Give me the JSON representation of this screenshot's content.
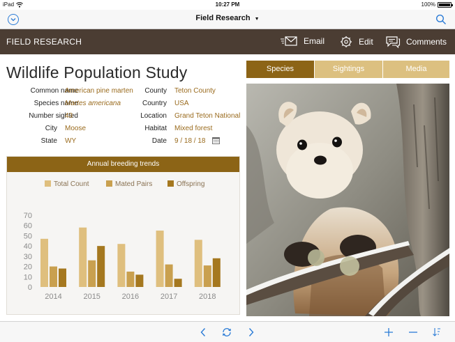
{
  "status_bar": {
    "device": "iPad",
    "time": "10:27 PM",
    "battery": "100%"
  },
  "nav": {
    "title": "Field Research"
  },
  "header": {
    "brand": "FIELD RESEARCH",
    "email_label": "Email",
    "edit_label": "Edit",
    "comments_label": "Comments"
  },
  "page_title": "Wildlife Population Study",
  "fields_left": [
    {
      "label": "Common name",
      "value": "American pine marten"
    },
    {
      "label": "Species name",
      "value": "Martes americana"
    },
    {
      "label": "Number sighted",
      "value": "43"
    },
    {
      "label": "City",
      "value": "Moose"
    },
    {
      "label": "State",
      "value": "WY"
    }
  ],
  "fields_right": [
    {
      "label": "County",
      "value": "Teton County"
    },
    {
      "label": "Country",
      "value": "USA"
    },
    {
      "label": "Location",
      "value": "Grand Teton National"
    },
    {
      "label": "Habitat",
      "value": "Mixed forest"
    },
    {
      "label": "Date",
      "value": "9 / 18 / 18"
    }
  ],
  "tabs": [
    {
      "label": "Species",
      "active": true
    },
    {
      "label": "Sightings",
      "active": false
    },
    {
      "label": "Media",
      "active": false
    }
  ],
  "colors": {
    "header_bg": "#4b3d33",
    "accent": "#8c6416",
    "tab_inactive": "#dcc080",
    "series_total": "#dfbf7e",
    "series_pairs": "#c9a04f",
    "series_offspring": "#a5781f",
    "link_blue": "#2a7bd6"
  },
  "icons": [
    "chevron-down-circle-icon",
    "search-icon",
    "email-icon",
    "edit-icon",
    "comments-icon",
    "calendar-icon",
    "back-icon",
    "refresh-icon",
    "forward-icon",
    "add-icon",
    "remove-icon",
    "sort-icon"
  ],
  "chart_data": {
    "type": "bar",
    "title": "Annual breeding trends",
    "categories": [
      "2014",
      "2015",
      "2016",
      "2017",
      "2018"
    ],
    "series": [
      {
        "name": "Total Count",
        "values": [
          47,
          58,
          42,
          55,
          46
        ],
        "color": "#dfbf7e"
      },
      {
        "name": "Mated Pairs",
        "values": [
          20,
          26,
          15,
          22,
          21
        ],
        "color": "#c9a04f"
      },
      {
        "name": "Offspring",
        "values": [
          18,
          40,
          12,
          8,
          28
        ],
        "color": "#a5781f"
      }
    ],
    "yticks": [
      "0",
      "10",
      "20",
      "30",
      "40",
      "50",
      "60",
      "70"
    ],
    "ylim": [
      0,
      70
    ],
    "grid": false,
    "legend": "top"
  }
}
